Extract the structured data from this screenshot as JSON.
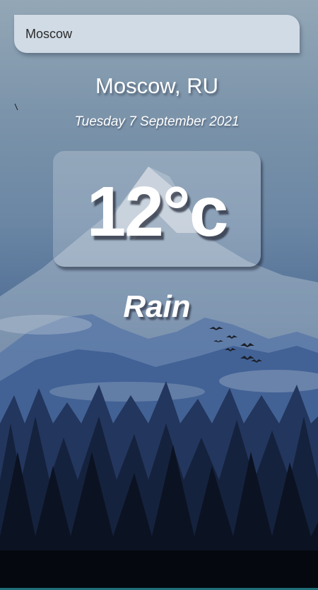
{
  "search": {
    "value": "Moscow"
  },
  "weather": {
    "location": "Moscow, RU",
    "date": "Tuesday 7 September 2021",
    "temperature": "12°c",
    "condition": "Rain"
  }
}
